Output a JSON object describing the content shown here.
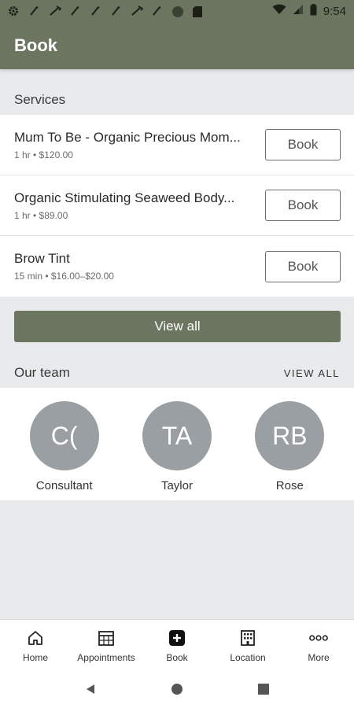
{
  "status_bar": {
    "time": "9:54",
    "icons": [
      "gear-icon",
      "wand-icon",
      "wrench-icon",
      "wand-icon",
      "wand-icon",
      "wand-icon",
      "wrench-icon",
      "wand-icon",
      "circle-icon",
      "sd-card-icon"
    ],
    "right_icons": [
      "wifi-icon",
      "signal-icon",
      "battery-icon"
    ]
  },
  "app_bar": {
    "title": "Book"
  },
  "services": {
    "title": "Services",
    "items": [
      {
        "name": "Mum To Be - Organic Precious Mom...",
        "meta": "1 hr  • $120.00",
        "button": "Book"
      },
      {
        "name": "Organic Stimulating Seaweed Body...",
        "meta": "1 hr  • $89.00",
        "button": "Book"
      },
      {
        "name": "Brow Tint",
        "meta": " 15 min • $16.00–$20.00",
        "button": "Book"
      }
    ],
    "view_all": "View all"
  },
  "team": {
    "title": "Our team",
    "view_all": "VIEW ALL",
    "members": [
      {
        "initials": "C(",
        "name": "Consultant"
      },
      {
        "initials": "TA",
        "name": "Taylor"
      },
      {
        "initials": "RB",
        "name": "Rose"
      }
    ]
  },
  "bottom_nav": {
    "items": [
      {
        "label": "Home",
        "icon": "home-icon"
      },
      {
        "label": "Appointments",
        "icon": "calendar-icon"
      },
      {
        "label": "Book",
        "icon": "add-box-icon"
      },
      {
        "label": "Location",
        "icon": "building-icon"
      },
      {
        "label": "More",
        "icon": "more-dots-icon"
      }
    ]
  },
  "system_nav": {
    "buttons": [
      "back-icon",
      "home-circle-icon",
      "recents-icon"
    ]
  },
  "colors": {
    "primary": "#6b7560",
    "avatar": "#9a9fa4",
    "background": "#e8eaec"
  }
}
